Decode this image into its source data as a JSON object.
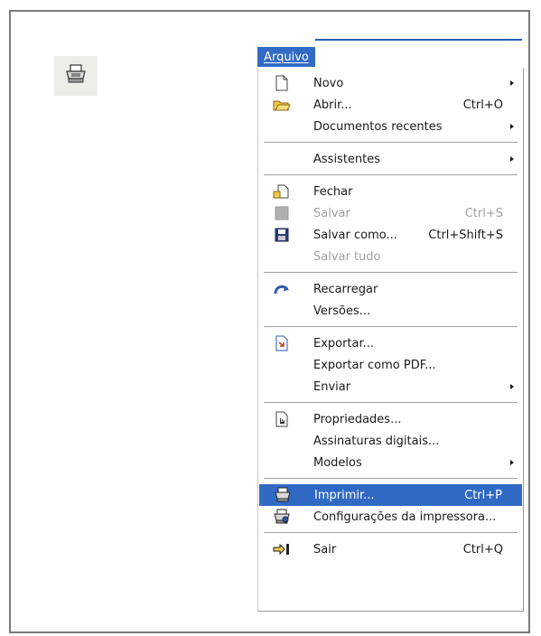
{
  "menu": {
    "title": "Arquivo",
    "groups": [
      [
        {
          "label": "Novo",
          "shortcut": "",
          "submenu": true,
          "icon": "new-document-icon"
        },
        {
          "label": "Abrir...",
          "shortcut": "Ctrl+O",
          "submenu": false,
          "icon": "open-folder-icon"
        },
        {
          "label": "Documentos recentes",
          "shortcut": "",
          "submenu": true,
          "icon": ""
        }
      ],
      [
        {
          "label": "Assistentes",
          "shortcut": "",
          "submenu": true,
          "icon": ""
        }
      ],
      [
        {
          "label": "Fechar",
          "shortcut": "",
          "submenu": false,
          "icon": "close-document-icon"
        },
        {
          "label": "Salvar",
          "shortcut": "Ctrl+S",
          "submenu": false,
          "icon": "save-disabled-icon",
          "disabled": true
        },
        {
          "label": "Salvar como...",
          "shortcut": "Ctrl+Shift+S",
          "submenu": false,
          "icon": "save-as-icon"
        },
        {
          "label": "Salvar tudo",
          "shortcut": "",
          "submenu": false,
          "icon": "",
          "disabled": true
        }
      ],
      [
        {
          "label": "Recarregar",
          "shortcut": "",
          "submenu": false,
          "icon": "reload-icon"
        },
        {
          "label": "Versões...",
          "shortcut": "",
          "submenu": false,
          "icon": ""
        }
      ],
      [
        {
          "label": "Exportar...",
          "shortcut": "",
          "submenu": false,
          "icon": "export-icon"
        },
        {
          "label": "Exportar como PDF...",
          "shortcut": "",
          "submenu": false,
          "icon": ""
        },
        {
          "label": "Enviar",
          "shortcut": "",
          "submenu": true,
          "icon": ""
        }
      ],
      [
        {
          "label": "Propriedades...",
          "shortcut": "",
          "submenu": false,
          "icon": "properties-icon"
        },
        {
          "label": "Assinaturas digitais...",
          "shortcut": "",
          "submenu": false,
          "icon": ""
        },
        {
          "label": "Modelos",
          "shortcut": "",
          "submenu": true,
          "icon": ""
        }
      ],
      [
        {
          "label": "Imprimir...",
          "shortcut": "Ctrl+P",
          "submenu": false,
          "icon": "printer-icon",
          "highlight": true
        },
        {
          "label": "Configurações da impressora...",
          "shortcut": "",
          "submenu": false,
          "icon": "printer-settings-icon"
        }
      ],
      [
        {
          "label": "Sair",
          "shortcut": "Ctrl+Q",
          "submenu": false,
          "icon": "exit-icon"
        }
      ]
    ]
  },
  "toolbar": {
    "icon": "printer-icon"
  },
  "colors": {
    "highlight": "#316ac5",
    "menu_title_bg": "#316ac5",
    "disabled_text": "#a0a0a0"
  }
}
